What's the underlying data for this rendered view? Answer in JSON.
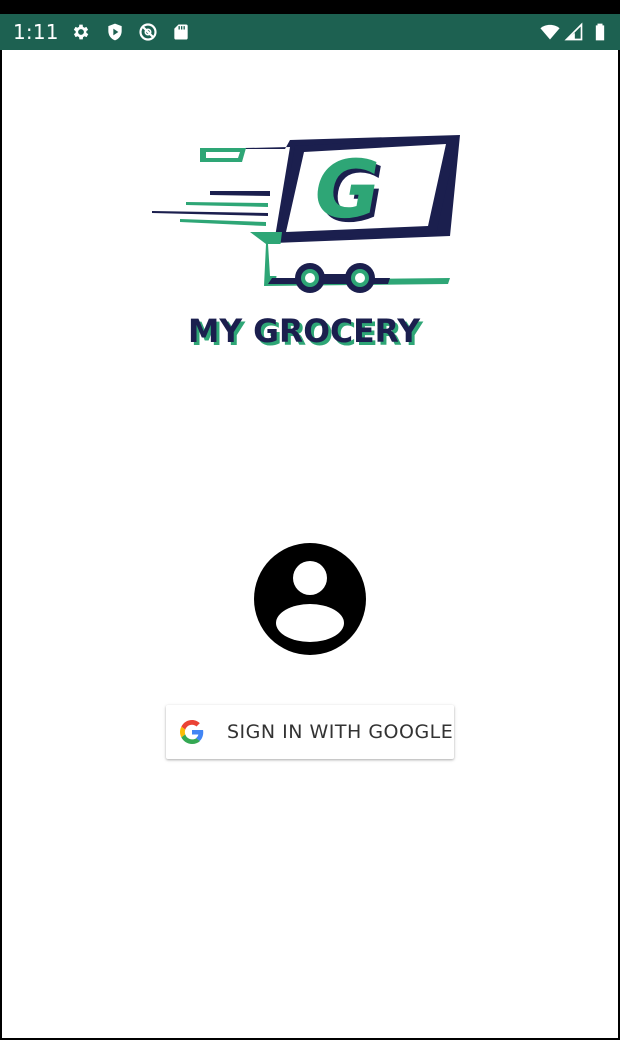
{
  "status_bar": {
    "time": "1:11",
    "icons": [
      "settings-icon",
      "shield-play-icon",
      "do-not-disturb-icon",
      "sd-card-icon",
      "wifi-icon",
      "cell-signal-icon",
      "battery-icon"
    ],
    "background_color": "#1d6151"
  },
  "logo": {
    "brand_text": "MY GROCERY",
    "emblem_letter": "G",
    "colors": {
      "navy": "#1b1f4e",
      "green": "#2ea676"
    }
  },
  "profile": {
    "avatar_icon": "account-circle-icon"
  },
  "sign_in": {
    "button_label": "SIGN IN WITH GOOGLE",
    "icon": "google-icon"
  }
}
